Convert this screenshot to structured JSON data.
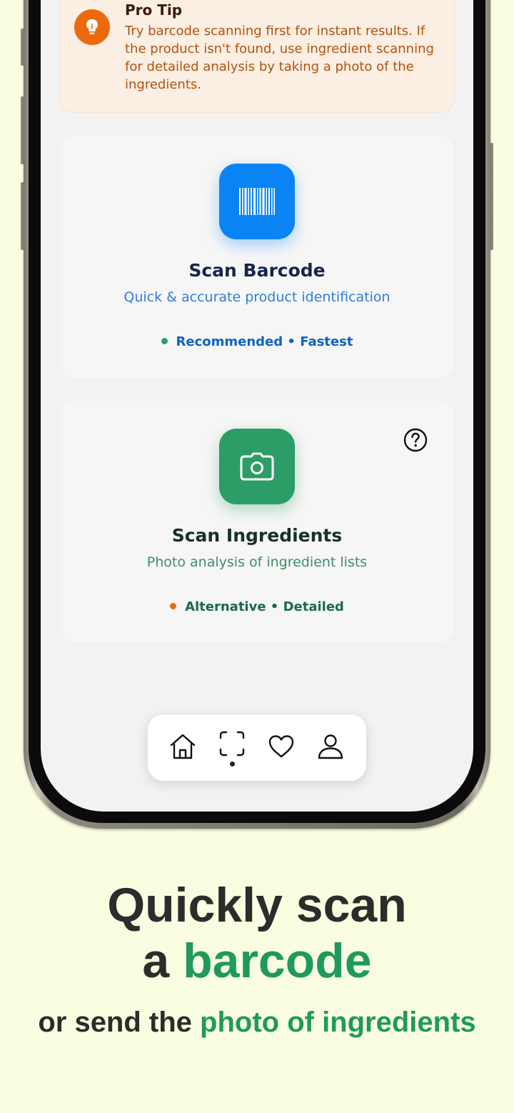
{
  "tip": {
    "title": "Pro Tip",
    "body": "Try barcode scanning first for instant results. If the product isn't found, use ingredient scanning for detailed analysis by taking a photo of the ingredients.",
    "icon": "lightbulb-icon"
  },
  "barcode_card": {
    "title": "Scan Barcode",
    "subtitle": "Quick & accurate product identification",
    "tag": "Recommended • Fastest",
    "icon": "barcode-icon",
    "accent": "#0a84f5"
  },
  "ingredients_card": {
    "title": "Scan Ingredients",
    "subtitle": "Photo analysis of ingredient lists",
    "tag": "Alternative • Detailed",
    "icon": "camera-icon",
    "accent": "#2c9d66"
  },
  "nav": {
    "items": [
      "home-icon",
      "scan-icon",
      "heart-icon",
      "profile-icon"
    ],
    "active": "scan-icon"
  },
  "headline": {
    "line1": "Quickly scan",
    "line2_prefix": "a ",
    "line2_highlight": "barcode"
  },
  "subline": {
    "prefix": "or send the ",
    "highlight": "photo of ingredients"
  },
  "colors": {
    "background": "#fafde0",
    "highlight_green": "#1f9a5c",
    "tip_orange": "#ec6a0f"
  }
}
